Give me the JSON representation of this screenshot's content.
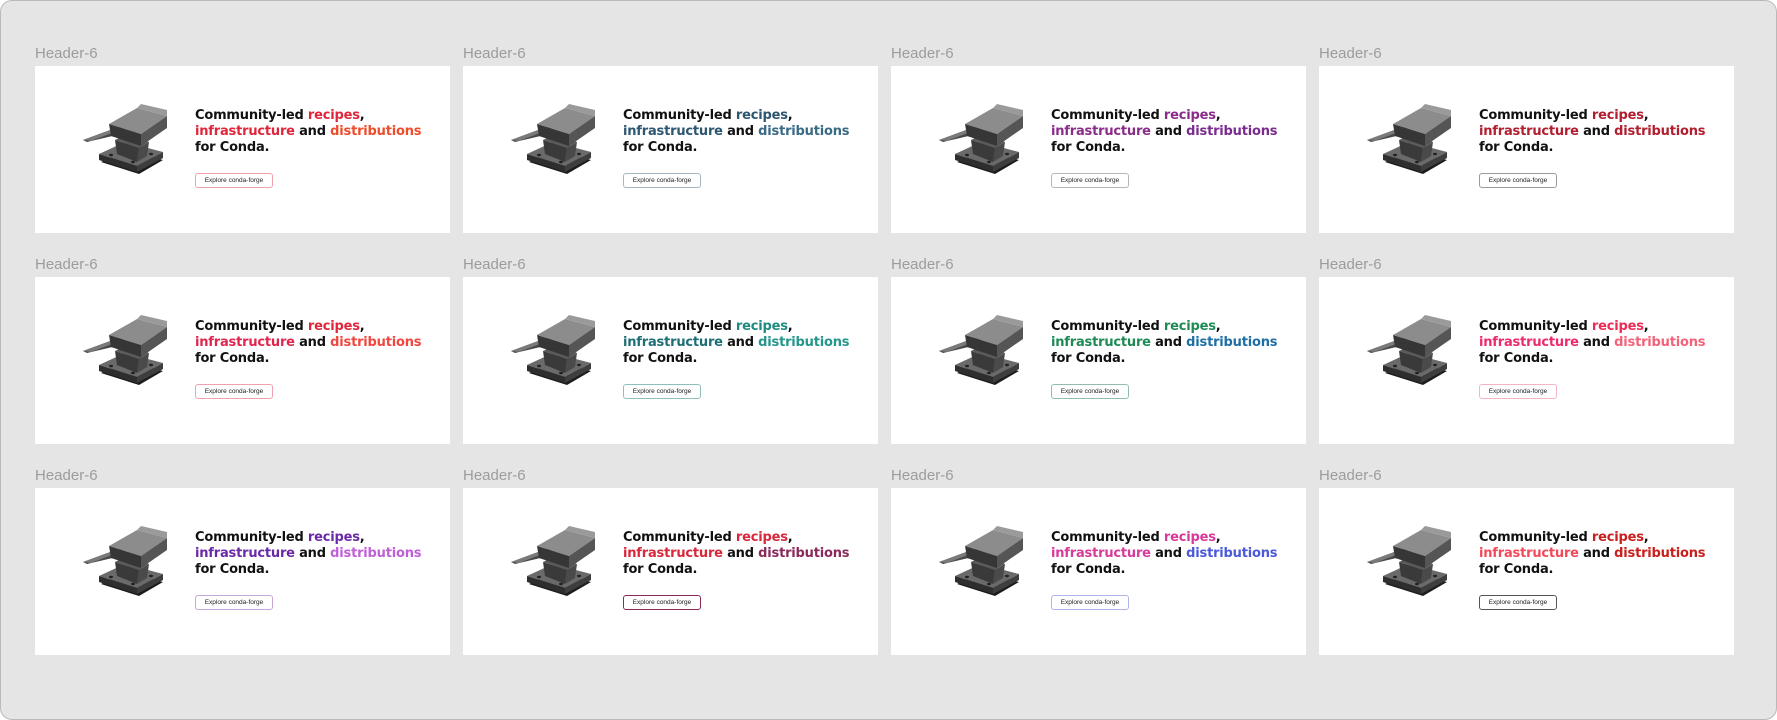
{
  "frames": [
    {
      "label": "Header-6",
      "line1": [
        "Community-led ",
        "recipes",
        ","
      ],
      "line2": [
        "infrastructure",
        " and ",
        "distributions"
      ],
      "line3": "for Conda.",
      "button": "Explore conda-forge",
      "colors": {
        "recipes": "#e0263a",
        "infrastructure": "#e0263a",
        "distributions": "#ee4d2c",
        "button_border": "#f2a0a8"
      }
    },
    {
      "label": "Header-6",
      "line1": [
        "Community-led ",
        "recipes",
        ","
      ],
      "line2": [
        "infrastructure",
        " and ",
        "distributions"
      ],
      "line3": "for Conda.",
      "button": "Explore conda-forge",
      "colors": {
        "recipes": "#2d5670",
        "infrastructure": "#2d5670",
        "distributions": "#3a6b85",
        "button_border": "#a4b6c2"
      }
    },
    {
      "label": "Header-6",
      "line1": [
        "Community-led ",
        "recipes",
        ","
      ],
      "line2": [
        "infrastructure",
        " and ",
        "distributions"
      ],
      "line3": "for Conda.",
      "button": "Explore conda-forge",
      "colors": {
        "recipes": "#8a2d88",
        "infrastructure": "#8a2d88",
        "distributions": "#7a2c8e",
        "button_border": "#b6b6b6"
      }
    },
    {
      "label": "Header-6",
      "line1": [
        "Community-led ",
        "recipes",
        ","
      ],
      "line2": [
        "infrastructure",
        " and ",
        "distributions"
      ],
      "line3": "for Conda.",
      "button": "Explore conda-forge",
      "colors": {
        "recipes": "#b01e2f",
        "infrastructure": "#b01e2f",
        "distributions": "#b01e2f",
        "button_border": "#9a9a9a"
      }
    },
    {
      "label": "Header-6",
      "line1": [
        "Community-led ",
        "recipes",
        ","
      ],
      "line2": [
        "infrastructure",
        " and ",
        "distributions"
      ],
      "line3": "for Conda.",
      "button": "Explore conda-forge",
      "colors": {
        "recipes": "#e0263a",
        "infrastructure": "#e0264e",
        "distributions": "#ef4840",
        "button_border": "#f0a0b0"
      }
    },
    {
      "label": "Header-6",
      "line1": [
        "Community-led ",
        "recipes",
        ","
      ],
      "line2": [
        "infrastructure",
        " and ",
        "distributions"
      ],
      "line3": "for Conda.",
      "button": "Explore conda-forge",
      "colors": {
        "recipes": "#1e8a80",
        "infrastructure": "#1e6f75",
        "distributions": "#24968c",
        "button_border": "#8fbfbb"
      }
    },
    {
      "label": "Header-6",
      "line1": [
        "Community-led ",
        "recipes",
        ","
      ],
      "line2": [
        "infrastructure",
        " and ",
        "distributions"
      ],
      "line3": "for Conda.",
      "button": "Explore conda-forge",
      "colors": {
        "recipes": "#1e8a55",
        "infrastructure": "#1e8a55",
        "distributions": "#1f6fa5",
        "button_border": "#8fbfa8"
      }
    },
    {
      "label": "Header-6",
      "line1": [
        "Community-led ",
        "recipes",
        ","
      ],
      "line2": [
        "infrastructure",
        " and ",
        "distributions"
      ],
      "line3": "for Conda.",
      "button": "Explore conda-forge",
      "colors": {
        "recipes": "#ec2c55",
        "infrastructure": "#ec2c6a",
        "distributions": "#f2637a",
        "button_border": "#f5b4c2"
      }
    },
    {
      "label": "Header-6",
      "line1": [
        "Community-led ",
        "recipes",
        ","
      ],
      "line2": [
        "infrastructure",
        " and ",
        "distributions"
      ],
      "line3": "for Conda.",
      "button": "Explore conda-forge",
      "colors": {
        "recipes": "#6a2aa8",
        "infrastructure": "#6a2aa8",
        "distributions": "#c060d8",
        "button_border": "#c7a6da"
      }
    },
    {
      "label": "Header-6",
      "line1": [
        "Community-led ",
        "recipes",
        ","
      ],
      "line2": [
        "infrastructure",
        " and ",
        "distributions"
      ],
      "line3": "for Conda.",
      "button": "Explore conda-forge",
      "colors": {
        "recipes": "#d8283c",
        "infrastructure": "#d8283c",
        "distributions": "#8a2a5a",
        "button_border": "#8a2a5a"
      }
    },
    {
      "label": "Header-6",
      "line1": [
        "Community-led ",
        "recipes",
        ","
      ],
      "line2": [
        "infrastructure",
        " and ",
        "distributions"
      ],
      "line3": "for Conda.",
      "button": "Explore conda-forge",
      "colors": {
        "recipes": "#d83a9a",
        "infrastructure": "#d83a9a",
        "distributions": "#4a5ad8",
        "button_border": "#b0b4e8"
      }
    },
    {
      "label": "Header-6",
      "line1": [
        "Community-led ",
        "recipes",
        ","
      ],
      "line2": [
        "infrastructure",
        " and ",
        "distributions"
      ],
      "line3": "for Conda.",
      "button": "Explore conda-forge",
      "colors": {
        "recipes": "#c8201e",
        "infrastructure": "#f24a5a",
        "distributions": "#c8201e",
        "button_border": "#555555"
      }
    }
  ],
  "icons": {
    "anvil": "anvil-icon"
  }
}
